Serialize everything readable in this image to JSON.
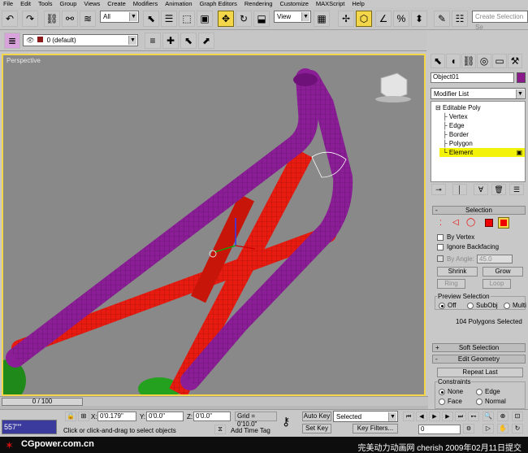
{
  "menu": [
    "File",
    "Edit",
    "Tools",
    "Group",
    "Views",
    "Create",
    "Modifiers",
    "Animation",
    "Graph Editors",
    "Rendering",
    "Customize",
    "MAXScript",
    "Help"
  ],
  "toolbar": {
    "selection_filter": "All",
    "reference_coord": "View",
    "named_selection_placeholder": "Create Selection Se"
  },
  "layer_toolbar": {
    "layer_name": "0 (default)"
  },
  "viewport": {
    "label": "Perspective"
  },
  "command_panel": {
    "object_name": "Object01",
    "object_color": "#8b1a8b",
    "modifier_list_label": "Modifier List",
    "stack": {
      "root": "Editable Poly",
      "sub_objects": [
        "Vertex",
        "Edge",
        "Border",
        "Polygon",
        "Element"
      ],
      "selected": "Element"
    },
    "selection_rollout": {
      "title": "Selection",
      "by_vertex": "By Vertex",
      "ignore_backfacing": "Ignore Backfacing",
      "by_angle": "By Angle:",
      "by_angle_value": "45.0",
      "shrink": "Shrink",
      "grow": "Grow",
      "ring": "Ring",
      "loop": "Loop",
      "preview_title": "Preview Selection",
      "preview_off": "Off",
      "preview_subobj": "SubObj",
      "preview_multi": "Multi",
      "status": "104 Polygons Selected"
    },
    "soft_selection_title": "Soft Selection",
    "edit_geometry": {
      "title": "Edit Geometry",
      "repeat_last": "Repeat Last",
      "constraints_title": "Constraints",
      "none": "None",
      "edge": "Edge",
      "face": "Face",
      "normal": "Normal"
    }
  },
  "timeline": {
    "frame_indicator": "0 / 100"
  },
  "status": {
    "counter": "557\"\"",
    "x_label": "X:",
    "x_value": "0'0.179\"",
    "y_label": "Y:",
    "y_value": "0'0.0\"",
    "z_label": "Z:",
    "z_value": "0'0.0\"",
    "grid": "Grid = 0'10.0\"",
    "prompt": "Click or click-and-drag to select objects",
    "add_time_tag": "Add Time Tag",
    "auto_key": "Auto Key",
    "set_key": "Set Key",
    "selected": "Selected",
    "key_filters": "Key Filters...",
    "current_frame": "0"
  },
  "watermark": {
    "site": "CGpower.com.cn",
    "credit": "完美动力动画网 cherish 2009年02月11日提交"
  },
  "colors": {
    "purple_tube": "#8b1e96",
    "red_tube": "#e81b10",
    "active_yellow": "#f3d64a"
  }
}
